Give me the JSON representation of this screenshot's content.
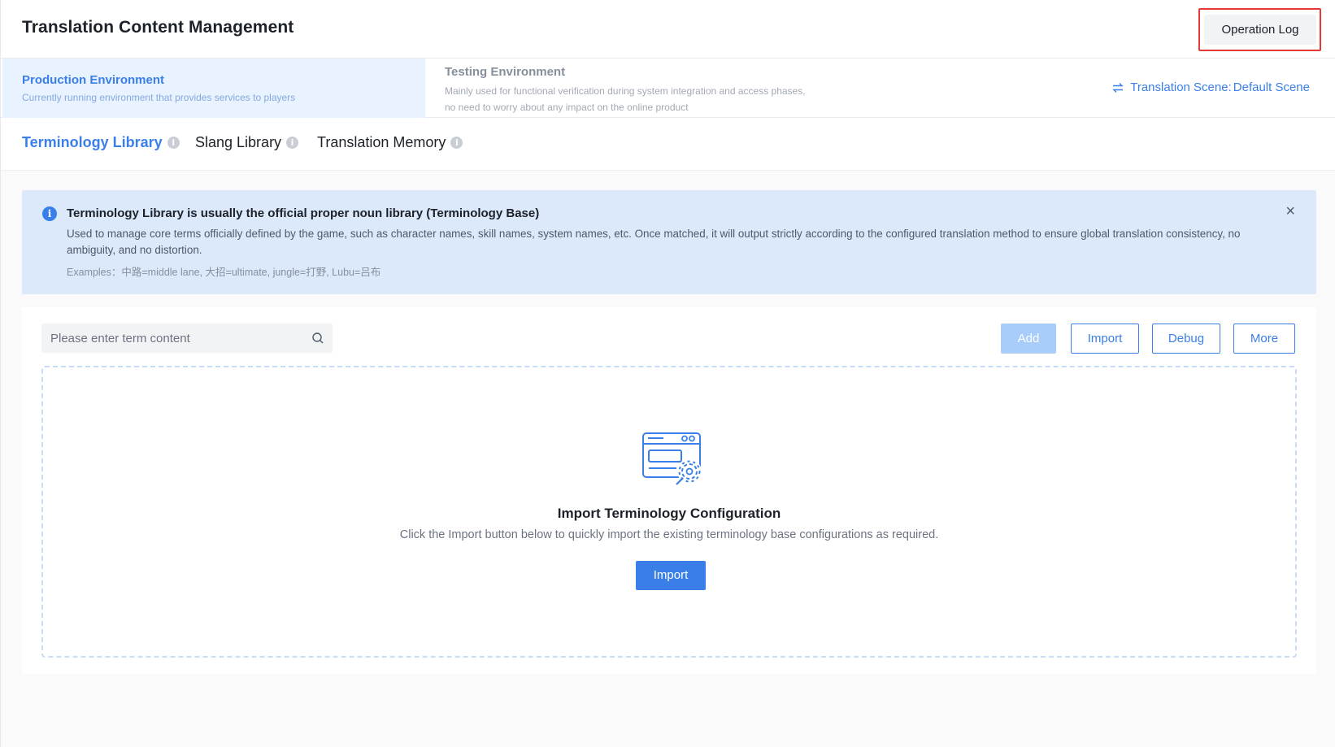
{
  "header": {
    "title": "Translation Content Management",
    "operation_log_label": "Operation Log"
  },
  "environments": {
    "production": {
      "name": "Production Environment",
      "description": "Currently running environment that provides services to players",
      "active": true
    },
    "testing": {
      "name": "Testing Environment",
      "description": "Mainly used for functional verification during system integration and access phases, no need to worry about any impact on the online product",
      "active": false
    },
    "scene_label": "Translation Scene",
    "scene_separator": ":",
    "scene_value": "Default Scene"
  },
  "tabs": [
    {
      "label": "Terminology Library",
      "active": true
    },
    {
      "label": "Slang Library",
      "active": false
    },
    {
      "label": "Translation Memory",
      "active": false
    }
  ],
  "alert": {
    "title": "Terminology Library is usually the official proper noun library (Terminology Base)",
    "body": "Used to manage core terms officially defined by the game, such as character names, skill names, system names, etc. Once matched, it will output strictly according to the configured translation method to ensure global translation consistency, no ambiguity, and no distortion.",
    "examples": "Examples：中路=middle lane, 大招=ultimate, jungle=打野, Lubu=吕布",
    "close_glyph": "×",
    "info_glyph": "i"
  },
  "toolbar": {
    "search_placeholder": "Please enter term content",
    "add_label": "Add",
    "import_label": "Import",
    "debug_label": "Debug",
    "more_label": "More"
  },
  "empty_state": {
    "title": "Import Terminology Configuration",
    "description": "Click the Import button below to quickly import the existing terminology base configurations as required.",
    "button_label": "Import"
  },
  "colors": {
    "primary": "#3a7fe8",
    "primary_disabled": "#a9cdfb",
    "alert_bg": "#dbe9fb",
    "highlight_border": "#e53935"
  },
  "icons": [
    "swap-icon",
    "info-icon",
    "close-icon",
    "search-icon",
    "import-config-illustration"
  ]
}
